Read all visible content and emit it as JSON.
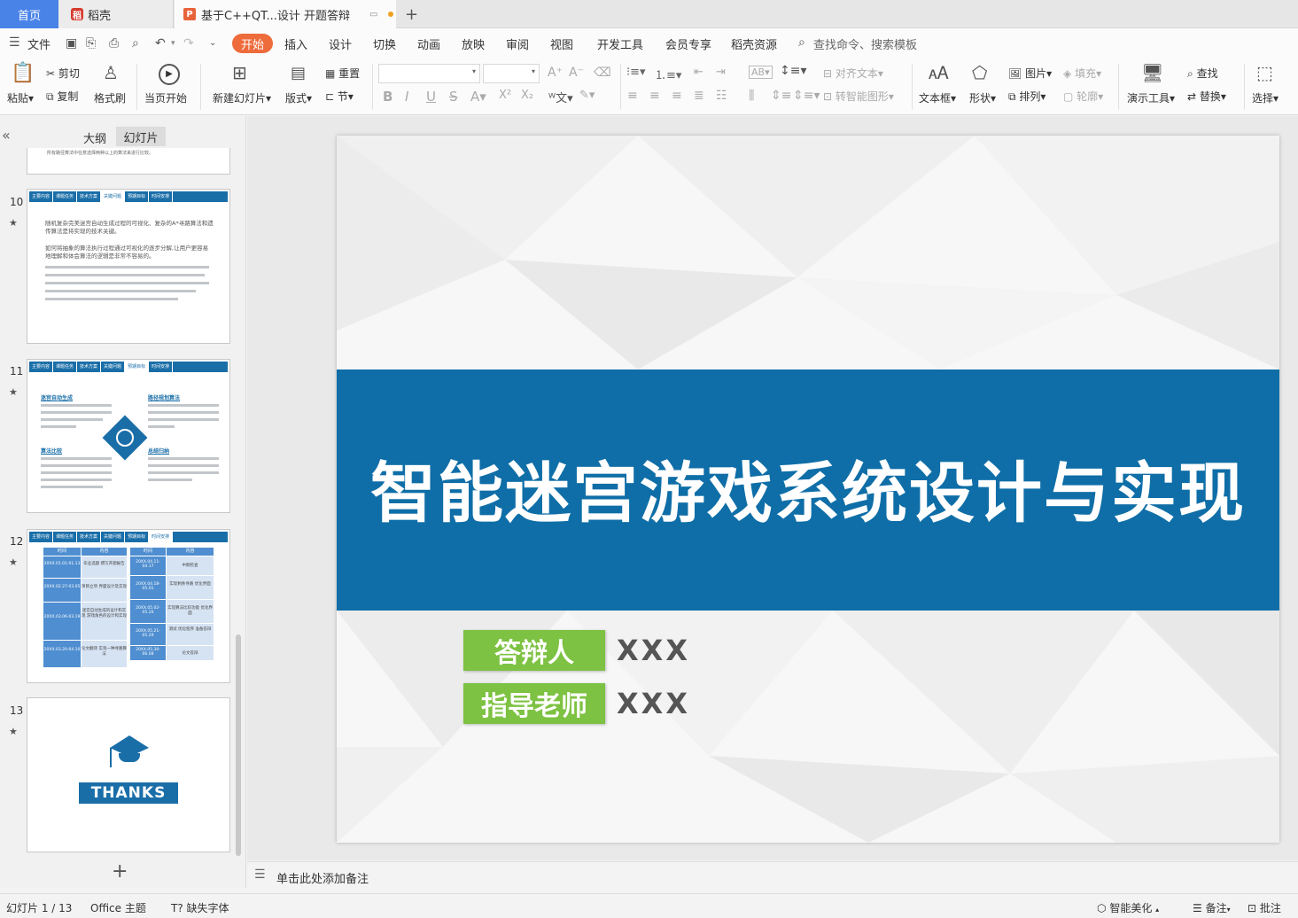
{
  "tabs": {
    "home": "首页",
    "docer": "稻壳",
    "doc": "基于C++QT...设计 开题答辩",
    "add": "+"
  },
  "menu": {
    "file": "文件",
    "items": [
      "开始",
      "插入",
      "设计",
      "切换",
      "动画",
      "放映",
      "审阅",
      "视图",
      "开发工具",
      "会员专享",
      "稻壳资源"
    ],
    "search": "查找命令、搜索模板"
  },
  "ribbon": {
    "paste": "粘贴",
    "cut": "剪切",
    "copy": "复制",
    "format_painter": "格式刷",
    "play_current": "当页开始",
    "new_slide": "新建幻灯片",
    "layout": "版式",
    "reset": "重置",
    "section": "节",
    "text_align": "对齐文本",
    "smart_graphic": "转智能图形",
    "text_box": "文本框",
    "shape": "形状",
    "picture": "图片",
    "fill": "填充",
    "arrange": "排列",
    "outline": "轮廓",
    "present_tools": "演示工具",
    "find": "查找",
    "replace": "替换",
    "select": "选择"
  },
  "left_panel": {
    "tab_outline": "大纲",
    "tab_slides": "幻灯片",
    "partial_slide_text": "所有路径算法中任意选择两种以上的算法来进行比较。",
    "slides": [
      {
        "num": "10",
        "nav": [
          "主要内容",
          "课题任务",
          "技术方案",
          "关键问题",
          "预期目标",
          "时间安排"
        ],
        "active": 3
      },
      {
        "num": "11",
        "nav": [
          "主要内容",
          "课题任务",
          "技术方案",
          "关键问题",
          "预期目标",
          "时间安排"
        ],
        "active": 4
      },
      {
        "num": "12",
        "nav": [
          "主要内容",
          "课题任务",
          "技术方案",
          "关键问题",
          "预期目标",
          "时间安排"
        ],
        "active": 5
      },
      {
        "num": "13",
        "thanks": "THANKS"
      }
    ],
    "slide10": {
      "p1": "随机复杂完美迷宫自动生成过程的可视化、复杂的A*寻路算法和遗传算法是将实现的技术关键。",
      "p2": "如何将抽象的算法执行过程通过可视化的逐步分解,让用户更容易地理解和体会算法的逻辑是非常不容易的。"
    },
    "slide11": {
      "h1": "迷宫自动生成",
      "h2": "路径规划算法",
      "h3": "算法比较",
      "h4": "总结归纳"
    },
    "slide12": {
      "col_time": "时间",
      "col_content": "内容",
      "left_rows": [
        {
          "t": "20XX.01.01-01.13",
          "c": "毕业选题 撰写开题报告"
        },
        {
          "t": "20XX.02.27-03.05",
          "c": "项目立项 界面设计及实现"
        },
        {
          "t": "20XX.03.06-03.19",
          "c": "迷宫自动生成的设计和实现 游戏角色的设计和实现"
        },
        {
          "t": "20XX.03.20-04.10",
          "c": "论文翻译 实现一种寻路算法"
        }
      ],
      "right_rows": [
        {
          "t": "20XX.04.11-04.17",
          "c": "中期检查"
        },
        {
          "t": "20XX.04.18-05.01",
          "c": "实现剩余寻路 优化界面"
        },
        {
          "t": "20XX.05.02-05.20",
          "c": "实现算法比较功能 优化界面"
        },
        {
          "t": "20XX.05.21-05.29",
          "c": "测试 优化程序 准备答辩"
        },
        {
          "t": "20XX.05.30-06.08",
          "c": "论文答辩"
        }
      ]
    },
    "add_slide": "+"
  },
  "slide": {
    "title": "智能迷宫游戏系统设计与实现",
    "label1": "答辩人",
    "value1": "XXX",
    "label2": "指导老师",
    "value2": "XXX",
    "band_color": "#0f6ea7",
    "label_color": "#7dc242"
  },
  "notes": {
    "placeholder": "单击此处添加备注"
  },
  "status": {
    "slide_count": "幻灯片 1 / 13",
    "theme": "Office 主题",
    "missing_fonts": "缺失字体",
    "beautify": "智能美化",
    "notes": "备注",
    "comments": "批注"
  }
}
